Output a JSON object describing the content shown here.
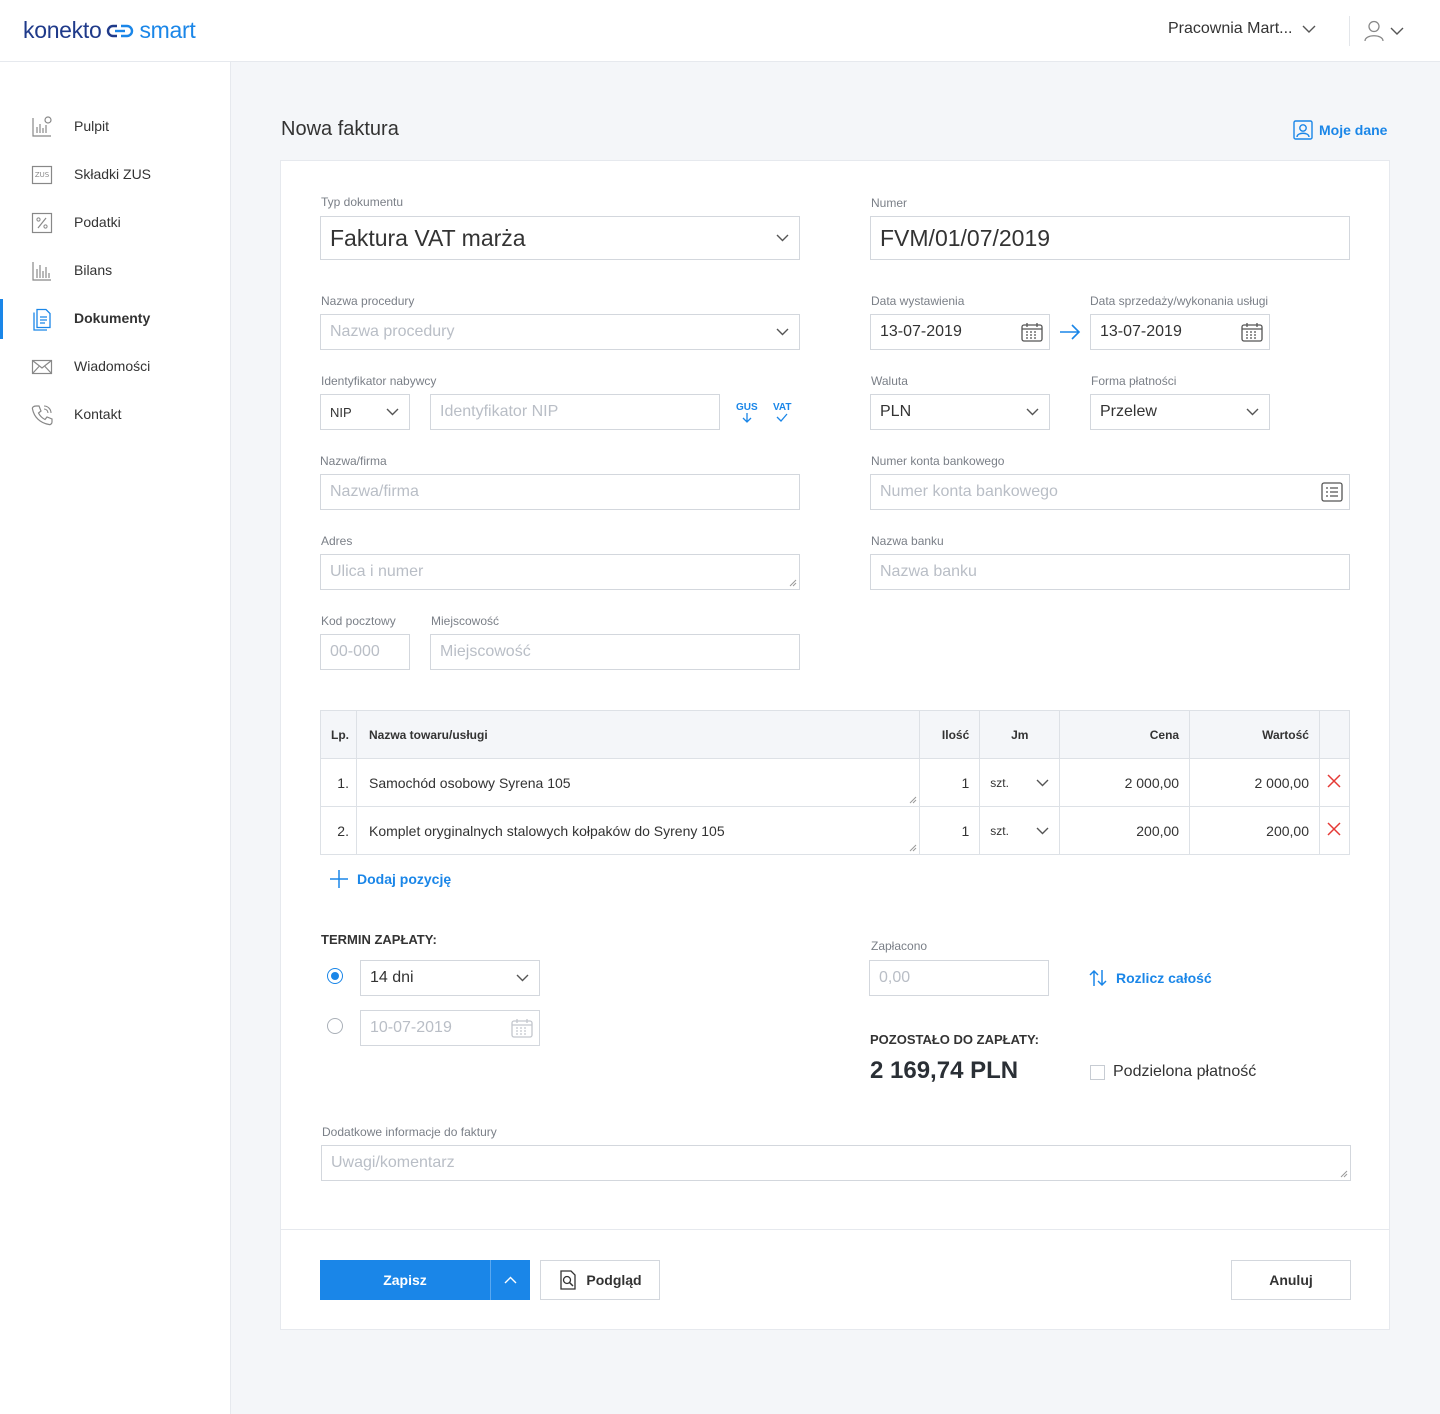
{
  "header": {
    "logo_left": "konekto",
    "logo_right": "smart",
    "workspace": "Pracownia Mart..."
  },
  "sidebar": {
    "items": [
      {
        "label": "Pulpit",
        "icon": "dashboard-icon"
      },
      {
        "label": "Składki ZUS",
        "icon": "zus-icon"
      },
      {
        "label": "Podatki",
        "icon": "percent-icon"
      },
      {
        "label": "Bilans",
        "icon": "bar-chart-icon"
      },
      {
        "label": "Dokumenty",
        "icon": "documents-icon",
        "active": true
      },
      {
        "label": "Wiadomości",
        "icon": "envelope-icon"
      },
      {
        "label": "Kontakt",
        "icon": "phone-icon"
      }
    ]
  },
  "page": {
    "title": "Nowa faktura",
    "my_data": "Moje dane"
  },
  "form": {
    "doc_type_label": "Typ dokumentu",
    "doc_type_value": "Faktura VAT marża",
    "number_label": "Numer",
    "number_value": "FVM/01/07/2019",
    "procedure_label": "Nazwa procedury",
    "procedure_placeholder": "Nazwa procedury",
    "issue_date_label": "Data wystawienia",
    "issue_date_value": "13-07-2019",
    "sale_date_label": "Data sprzedaży/wykonania usługi",
    "sale_date_value": "13-07-2019",
    "buyer_id_label": "Identyfikator nabywcy",
    "buyer_id_type": "NIP",
    "buyer_id_placeholder": "Identyfikator NIP",
    "gus_label": "GUS",
    "vat_label": "VAT",
    "currency_label": "Waluta",
    "currency_value": "PLN",
    "payment_form_label": "Forma płatności",
    "payment_form_value": "Przelew",
    "company_label": "Nazwa/firma",
    "company_placeholder": "Nazwa/firma",
    "account_label": "Numer konta bankowego",
    "account_placeholder": "Numer konta bankowego",
    "address_label": "Adres",
    "address_placeholder": "Ulica i numer",
    "bank_label": "Nazwa banku",
    "bank_placeholder": "Nazwa banku",
    "postal_label": "Kod pocztowy",
    "postal_placeholder": "00-000",
    "city_label": "Miejscowość",
    "city_placeholder": "Miejscowość"
  },
  "items_table": {
    "headers": {
      "lp": "Lp.",
      "name": "Nazwa towaru/usługi",
      "qty": "Ilość",
      "unit": "Jm",
      "price": "Cena",
      "value": "Wartość"
    },
    "rows": [
      {
        "lp": "1.",
        "name": "Samochód osobowy Syrena 105",
        "qty": "1",
        "unit": "szt.",
        "price": "2 000,00",
        "value": "2 000,00"
      },
      {
        "lp": "2.",
        "name": "Komplet oryginalnych stalowych kołpaków do Syreny 105",
        "qty": "1",
        "unit": "szt.",
        "price": "200,00",
        "value": "200,00"
      }
    ],
    "add_label": "Dodaj pozycję"
  },
  "payment": {
    "term_title": "TERMIN ZAPŁATY:",
    "term_option_days": "14 dni",
    "term_option_date_placeholder": "10-07-2019",
    "paid_label": "Zapłacono",
    "paid_placeholder": "0,00",
    "settle_label": "Rozlicz całość",
    "remaining_label": "POZOSTAŁO DO ZAPŁATY:",
    "remaining_amount": "2 169,74 PLN",
    "split_label": "Podzielona płatność"
  },
  "notes": {
    "label": "Dodatkowe informacje do faktury",
    "placeholder": "Uwagi/komentarz"
  },
  "actions": {
    "save": "Zapisz",
    "preview": "Podgląd",
    "cancel": "Anuluj"
  },
  "colors": {
    "accent": "#1a86e8",
    "brand_dark": "#1f3a8a",
    "delete": "#e53935"
  }
}
